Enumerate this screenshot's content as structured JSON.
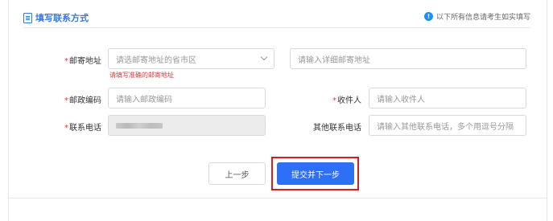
{
  "header": {
    "title": "填写联系方式",
    "note": "以下所有信息请考生如实填写"
  },
  "form": {
    "mail_address_label": "邮寄地址",
    "province_placeholder": "请选邮寄地址的省市区",
    "detail_address_placeholder": "请输入详细邮寄地址",
    "address_error": "请填写准确的邮寄地址",
    "postal_code_label": "邮政编码",
    "postal_code_placeholder": "请输入邮政编码",
    "recipient_label": "收件人",
    "recipient_placeholder": "请输入收件人",
    "phone_label": "联系电话",
    "other_phone_label": "其他联系电话",
    "other_phone_placeholder": "请输入其他联系电话，多个用逗号分隔",
    "required_mark": "*"
  },
  "buttons": {
    "prev_label": "上一步",
    "next_label": "提交并下一步"
  }
}
